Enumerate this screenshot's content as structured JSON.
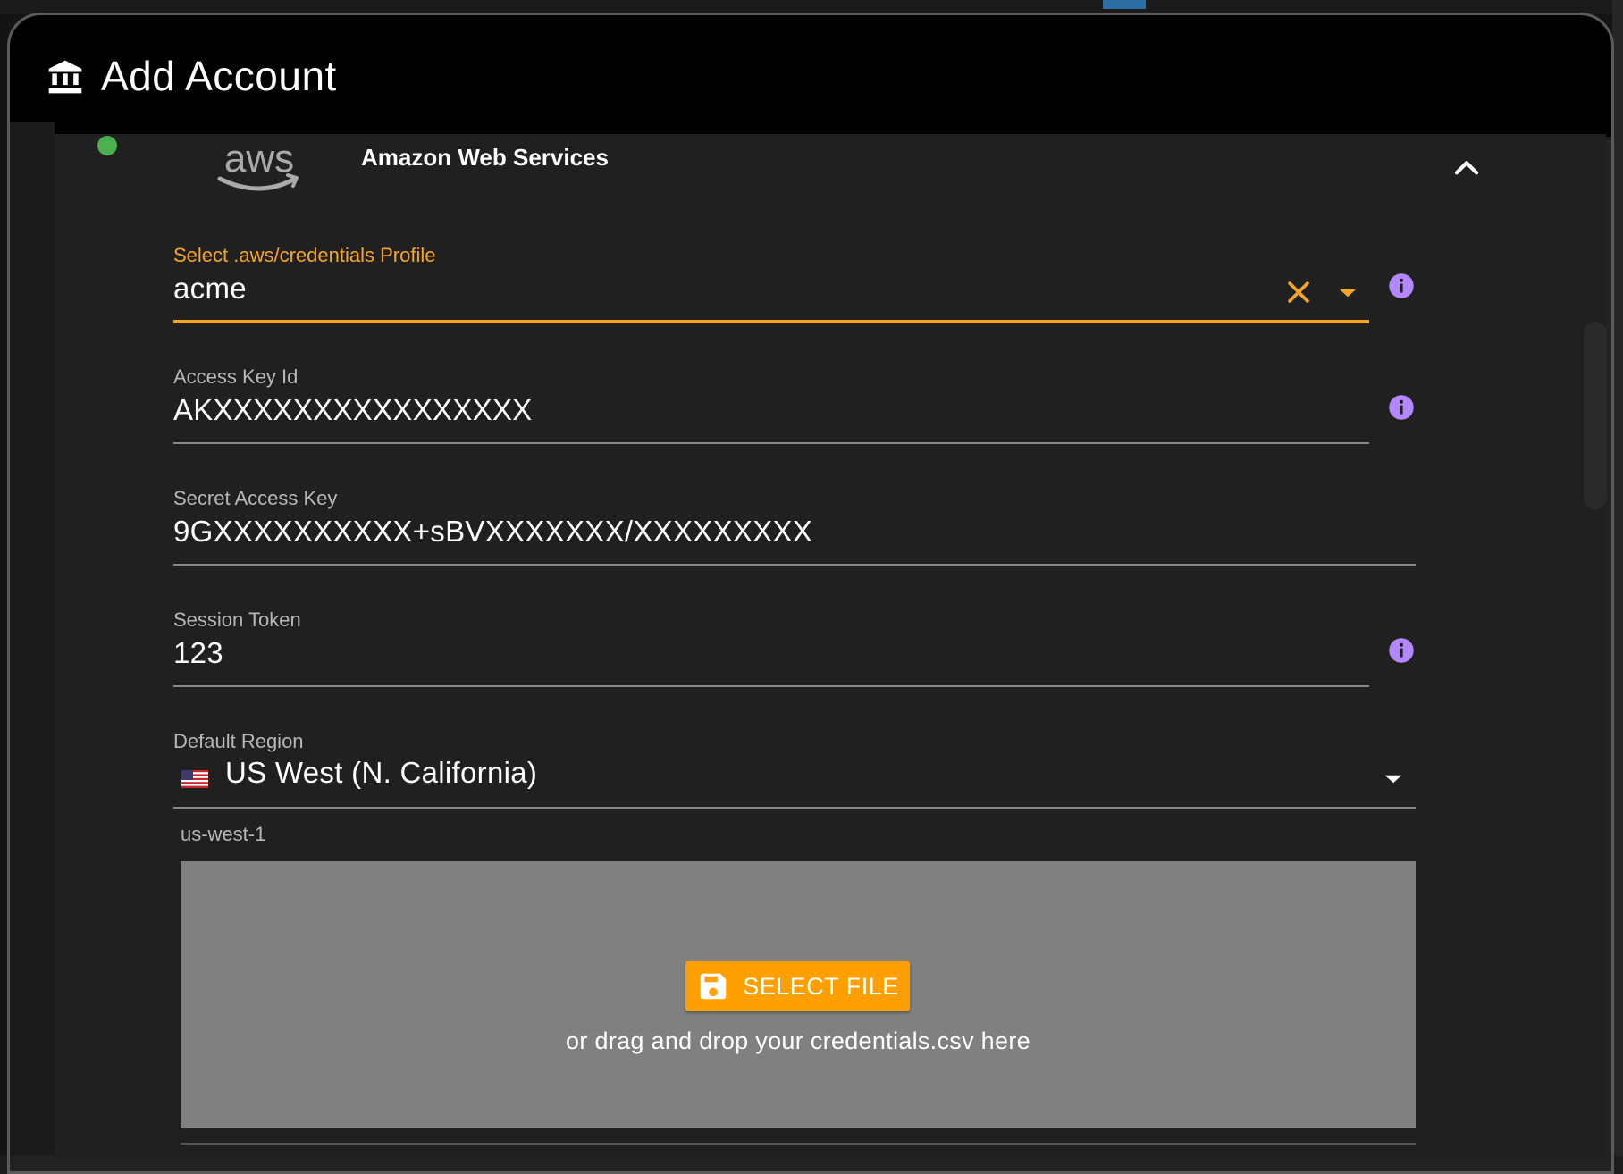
{
  "dialog": {
    "title": "Add Account",
    "title_icon": "bank-icon"
  },
  "provider": {
    "name": "Amazon Web Services",
    "logo_text": "aws",
    "status_color": "#4caf50"
  },
  "form": {
    "profile": {
      "label": "Select .aws/credentials Profile",
      "value": "acme"
    },
    "access_key_id": {
      "label": "Access Key Id",
      "value": "AKXXXXXXXXXXXXXXXX"
    },
    "secret_access_key": {
      "label": "Secret Access Key",
      "value": "9GXXXXXXXXXX+sBVXXXXXXX/XXXXXXXXX"
    },
    "session_token": {
      "label": "Session Token",
      "value": "123"
    },
    "default_region": {
      "label": "Default Region",
      "value": "US West (N. California)",
      "helper": "us-west-1",
      "flag": "us-flag-icon"
    }
  },
  "upload": {
    "button_label": "SELECT FILE",
    "hint": "or drag and drop your credentials.csv here"
  },
  "colors": {
    "accent": "#f5a623",
    "info": "#b388ff",
    "button": "#ffa000",
    "dropzone": "#808080"
  }
}
